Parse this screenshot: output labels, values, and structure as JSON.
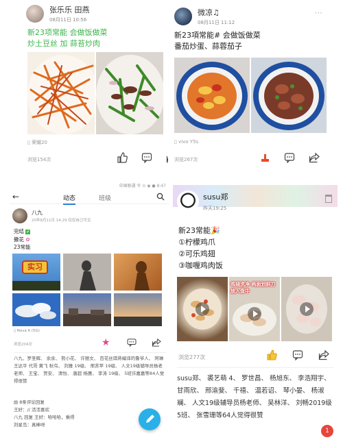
{
  "card1": {
    "user": "张乐乐 田燕",
    "time": "08月11日 10:56",
    "text_line1": "新23项常能 会做饭做菜",
    "text_line2": "炒土豆丝 加 蒜苔炒肉",
    "device": "荣耀20",
    "views": "浏览154次"
  },
  "card2": {
    "user": "微凉♫",
    "time": "08月11日 11:12",
    "text_line1": "新23項常能# 会做饭做菜",
    "text_line2": "番茄炒蛋、蒜蓉茄子",
    "device": "vivo Y5s",
    "views": "浏览267次"
  },
  "card3": {
    "statusbar": "中国联通 令 ⊙ ◉ ● 8:47",
    "tab_active": "动态",
    "tab_other": "班级",
    "user": "八九",
    "meta": "20年8月11日 14:29  仅仅自己可见",
    "text_line1": "完结",
    "text_line2": "撒花",
    "text_line3": "23常能",
    "badge": "实习",
    "device": "Nova 6 (5G)",
    "views": "浏览204次",
    "likes": "八九、罗圣辉、 余余、 熊小花、 许丽文、 百花丝琪蒋编译的鲁爷人、 阿琳 王达平 代哥 黄飞 秋鸟、 刘雅 19级、 邢苏苹 19级、 人文19级辅导员杨老老师、 王宝、 贺安、 清怡、 唐超 杨蕙、 李涛 19级、 5班许嘉嘉等84人觉得很赞",
    "comments_header": "8条评论回复",
    "comment1": "王好：// 活活喜欢",
    "comment2": "八九 回复 王好：哈哈哈，乘得",
    "comment3": "刘星岛：真棒呀"
  },
  "card4": {
    "user": "susu郑",
    "time": "昨天19:25",
    "text_line1": "新23常能🎉",
    "text_line2": "①柠檬鸡爪",
    "text_line3": "②可乐鸡翅",
    "text_line4": "③咖喱鸡肉饭",
    "photo2_caption": "鸡翅洗净 两面划斜刀 放入盘中",
    "views": "浏览277次",
    "likes": "susu郑、 裘艺萌 4、 罗世昌、 杨旭东、 李浩翔宇、 甘雨欣、 邢渝斐、 千禧、 温若诏、 琴小晏、 杨淑斓、 人文19级辅导员杨老师、 吴林洋、 刘畅2019级5班、 张雪珊等64人觉得很赞",
    "notif_count": "1"
  }
}
